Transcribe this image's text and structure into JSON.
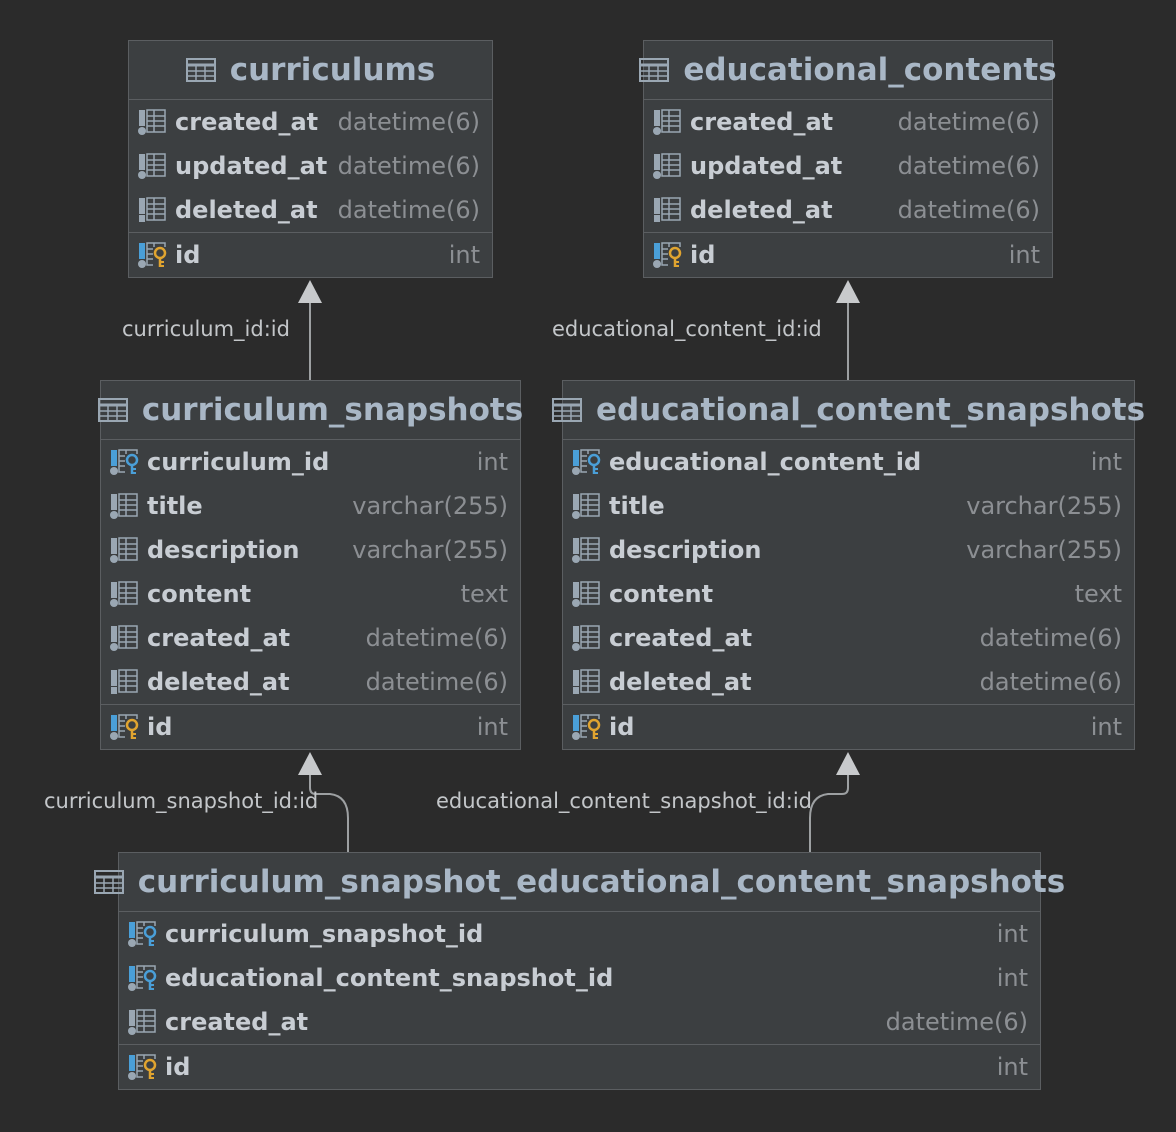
{
  "colors": {
    "background": "#2b2b2b",
    "table_bg": "#3c3f41",
    "border": "#5b5e61",
    "edge": "#9da0a2",
    "fk_key": "#4a9fd8",
    "pk_key": "#e0a430"
  },
  "edges": [
    {
      "label": "curriculum_id:id"
    },
    {
      "label": "educational_content_id:id"
    },
    {
      "label": "curriculum_snapshot_id:id"
    },
    {
      "label": "educational_content_snapshot_id:id"
    }
  ],
  "tables": {
    "curriculums": {
      "title": "curriculums",
      "columns": [
        {
          "name": "created_at",
          "type": "datetime(6)",
          "icon": "column-icon"
        },
        {
          "name": "updated_at",
          "type": "datetime(6)",
          "icon": "column-icon"
        },
        {
          "name": "deleted_at",
          "type": "datetime(6)",
          "icon": "column-nullable-icon"
        }
      ],
      "pk": {
        "name": "id",
        "type": "int",
        "icon": "primary-key-icon"
      }
    },
    "educational_contents": {
      "title": "educational_contents",
      "columns": [
        {
          "name": "created_at",
          "type": "datetime(6)",
          "icon": "column-icon"
        },
        {
          "name": "updated_at",
          "type": "datetime(6)",
          "icon": "column-icon"
        },
        {
          "name": "deleted_at",
          "type": "datetime(6)",
          "icon": "column-nullable-icon"
        }
      ],
      "pk": {
        "name": "id",
        "type": "int",
        "icon": "primary-key-icon"
      }
    },
    "curriculum_snapshots": {
      "title": "curriculum_snapshots",
      "columns": [
        {
          "name": "curriculum_id",
          "type": "int",
          "icon": "foreign-key-icon"
        },
        {
          "name": "title",
          "type": "varchar(255)",
          "icon": "column-icon"
        },
        {
          "name": "description",
          "type": "varchar(255)",
          "icon": "column-icon"
        },
        {
          "name": "content",
          "type": "text",
          "icon": "column-icon"
        },
        {
          "name": "created_at",
          "type": "datetime(6)",
          "icon": "column-icon"
        },
        {
          "name": "deleted_at",
          "type": "datetime(6)",
          "icon": "column-nullable-icon"
        }
      ],
      "pk": {
        "name": "id",
        "type": "int",
        "icon": "primary-key-icon"
      }
    },
    "educational_content_snapshots": {
      "title": "educational_content_snapshots",
      "columns": [
        {
          "name": "educational_content_id",
          "type": "int",
          "icon": "foreign-key-icon"
        },
        {
          "name": "title",
          "type": "varchar(255)",
          "icon": "column-icon"
        },
        {
          "name": "description",
          "type": "varchar(255)",
          "icon": "column-icon"
        },
        {
          "name": "content",
          "type": "text",
          "icon": "column-icon"
        },
        {
          "name": "created_at",
          "type": "datetime(6)",
          "icon": "column-icon"
        },
        {
          "name": "deleted_at",
          "type": "datetime(6)",
          "icon": "column-nullable-icon"
        }
      ],
      "pk": {
        "name": "id",
        "type": "int",
        "icon": "primary-key-icon"
      }
    },
    "join": {
      "title": "curriculum_snapshot_educational_content_snapshots",
      "columns": [
        {
          "name": "curriculum_snapshot_id",
          "type": "int",
          "icon": "foreign-key-icon"
        },
        {
          "name": "educational_content_snapshot_id",
          "type": "int",
          "icon": "foreign-key-icon"
        },
        {
          "name": "created_at",
          "type": "datetime(6)",
          "icon": "column-icon"
        }
      ],
      "pk": {
        "name": "id",
        "type": "int",
        "icon": "primary-key-icon"
      }
    }
  }
}
